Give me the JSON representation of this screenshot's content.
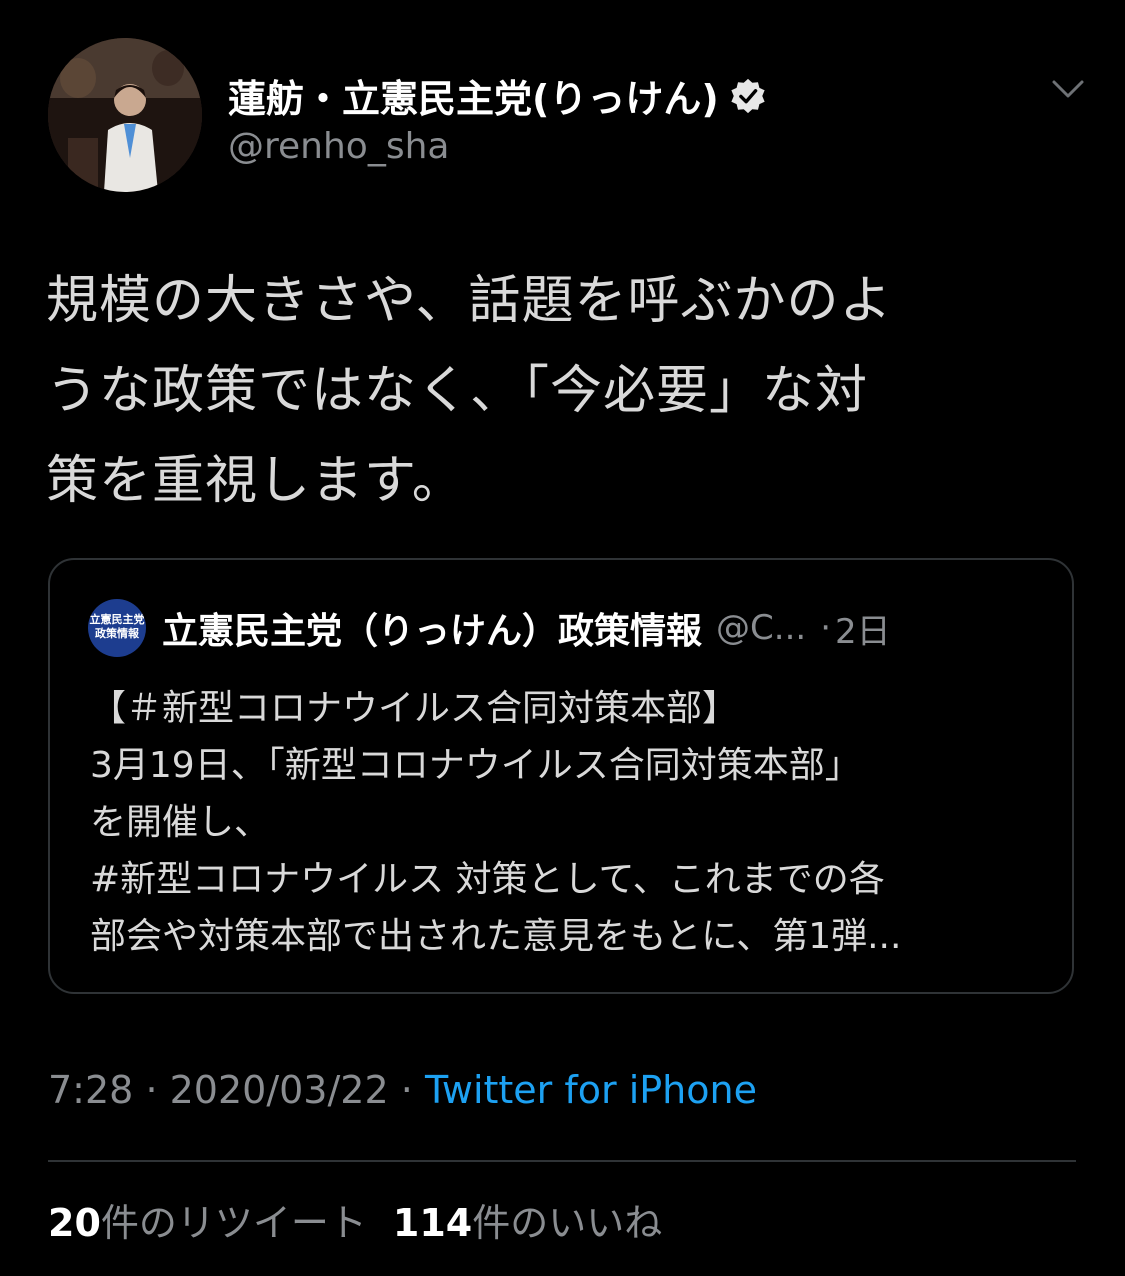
{
  "author": {
    "display_name": "蓮舫・立憲民主党(りっけん)",
    "handle": "@renho_sha",
    "verified": true
  },
  "tweet": {
    "text_lines": [
      "規模の大きさや、話題を呼ぶかのよ",
      "うな政策ではなく、「今必要」な対",
      "策を重視します。"
    ],
    "time": "7:28",
    "date": "2020/03/22",
    "separator": "·",
    "source": "Twitter for iPhone"
  },
  "quoted_tweet": {
    "avatar_text": [
      "立憲民主党",
      "政策情報"
    ],
    "name": "立憲民主党（りっけん）政策情報",
    "handle": "@C...",
    "time_separator": "·",
    "time": "2日",
    "body_lines": [
      "【＃新型コロナウイルス合同対策本部】",
      "3月19日、「新型コロナウイルス合同対策本部」",
      "を開催し、",
      "#新型コロナウイルス  対策として、これまでの各",
      "部会や対策本部で出された意見をもとに、第1弾..."
    ]
  },
  "stats": {
    "retweets_count": "20",
    "retweets_label": "件のリツイート",
    "likes_count": "114",
    "likes_label": "件のいいね"
  },
  "icons": {
    "verified": "verified-badge-icon",
    "more": "chevron-down-icon"
  },
  "colors": {
    "background": "#000000",
    "text": "#d9d9d9",
    "secondary": "#8a8d91",
    "link": "#1da1f2",
    "border": "#2f3336"
  }
}
